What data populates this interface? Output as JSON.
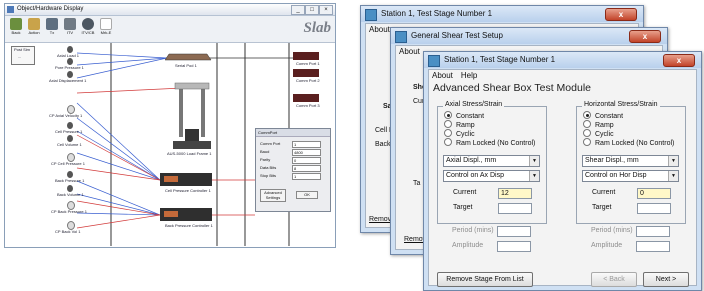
{
  "left_window": {
    "title": "Object/Hardware Display",
    "brand": "Slab",
    "window_buttons": [
      "_",
      "□",
      "×"
    ],
    "toolbar": [
      {
        "label": "Back",
        "icon": "back-icon"
      },
      {
        "label": "Action",
        "icon": "action-icon"
      },
      {
        "label": "Tx",
        "icon": "tx-icon"
      },
      {
        "label": "ITV",
        "icon": "itv-icon"
      },
      {
        "label": "ITV/CB",
        "icon": "itvcb-icon"
      },
      {
        "label": "Mrk-E",
        "icon": "mark-icon"
      }
    ],
    "post_sim": {
      "title": "Post Sim",
      "label": "..."
    },
    "sensors": [
      "Axial Load 1",
      "Pore Pressure 1",
      "Axial Displacement 1",
      "CP Axial Velocity 1",
      "Cell Pressure 1",
      "Cell Volume 1",
      "CP Cell Pressure 1",
      "Back Pressure 1",
      "Back Volume 1",
      "CP Back Pressure 1",
      "CP Back Vol 1"
    ],
    "devices": {
      "serial_pod": "Serial Pod 1",
      "load_frame": "AUS-5000 Load Frame 1",
      "cell_controller": "Cell Pressure Controller 1",
      "back_controller": "Back Pressure Controller 1",
      "comm_port_1": "Comm Port 1",
      "comm_port_2": "Comm Port 2",
      "comm_port_3": "Comm Port 3"
    },
    "comm_dialog": {
      "title": "CommPort",
      "fields": [
        {
          "label": "Comm Port",
          "value": "1"
        },
        {
          "label": "Baud",
          "value": "4800"
        },
        {
          "label": "Parity",
          "value": "0"
        },
        {
          "label": "Data Bits",
          "value": "8"
        },
        {
          "label": "Stop Bits",
          "value": "1"
        }
      ],
      "advanced_label": "Advanced Settings",
      "ok_label": "OK"
    }
  },
  "win1": {
    "title": "Station 1, Test Stage Number 1",
    "close": "x",
    "menu": [
      "About"
    ],
    "frag_sa": "Sa",
    "frag_cell": "Cell P",
    "frag_back": "Back",
    "frag_remove": "Remove"
  },
  "win2": {
    "title": "General Shear Test Setup",
    "close": "x",
    "menu": [
      "About"
    ],
    "frag_she": "She",
    "frag_cur": "Cur",
    "frag_ta": "Ta",
    "frag_remove": "Remove"
  },
  "win3": {
    "title": "Station 1, Test Stage Number 1",
    "close": "x",
    "menu": [
      "About",
      "Help"
    ],
    "heading": "Advanced Shear Box Test Module",
    "axial": {
      "group_title": "Axial Stress/Strain",
      "options": [
        "Constant",
        "Ramp",
        "Cyclic",
        "Ram Locked (No Control)"
      ],
      "selected": 0,
      "disp_select": "Axial Displ., mm",
      "control_select": "Control on Ax Disp",
      "current_label": "Current",
      "current_value": "12",
      "target_label": "Target",
      "target_value": "",
      "period_label": "Period (mins)",
      "amplitude_label": "Amplitude"
    },
    "horizontal": {
      "group_title": "Horizontal Stress/Strain",
      "options": [
        "Constant",
        "Ramp",
        "Cyclic",
        "Ram Locked (No Control)"
      ],
      "selected": 0,
      "disp_select": "Shear Displ., mm",
      "control_select": "Control on Hor Disp",
      "current_label": "Current",
      "current_value": "0",
      "target_label": "Target",
      "target_value": "",
      "period_label": "Period (mins)",
      "amplitude_label": "Amplitude"
    },
    "remove_button": "Remove Stage From List",
    "back_button": "< Back",
    "next_button": "Next >"
  }
}
